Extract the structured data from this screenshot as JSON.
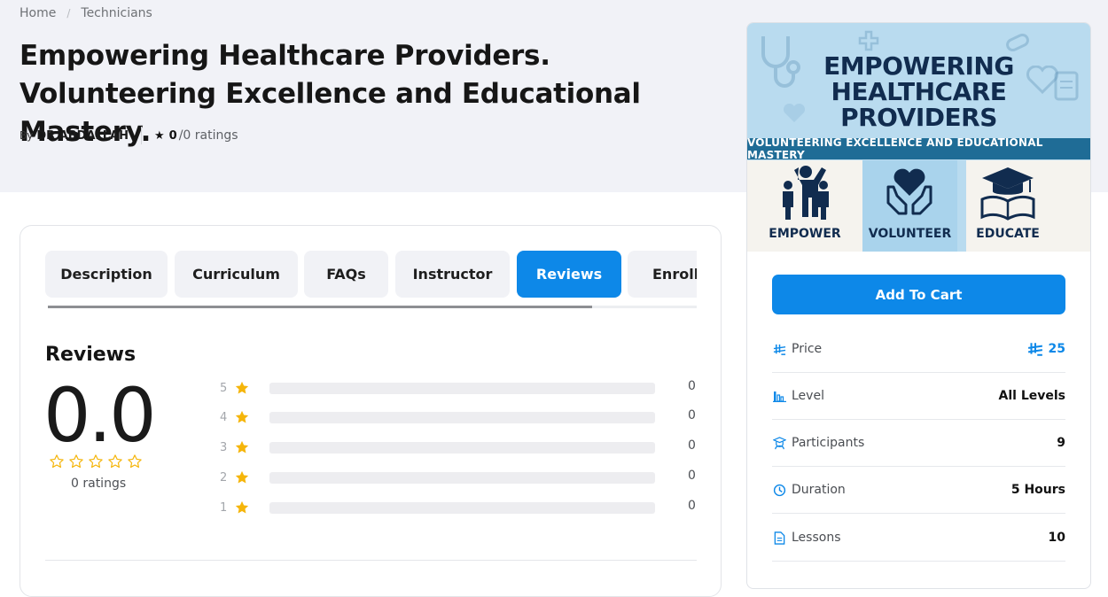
{
  "breadcrumb": {
    "home": "Home",
    "separator": "/",
    "current": "Technicians"
  },
  "course": {
    "title": "Empowering Healthcare Providers. Volunteering Excellence and Educational Mastery.",
    "by_label": "By",
    "author": "DR ABDALLAH",
    "rating_value": "0",
    "rating_text": "/0 ratings"
  },
  "tabs": [
    {
      "label": "Description",
      "active": false
    },
    {
      "label": "Curriculum",
      "active": false
    },
    {
      "label": "FAQs",
      "active": false
    },
    {
      "label": "Instructor",
      "active": false
    },
    {
      "label": "Reviews",
      "active": true
    },
    {
      "label": "Enrolled",
      "active": false
    }
  ],
  "reviews": {
    "heading": "Reviews",
    "average": "0.0",
    "ratings_label": "0 ratings",
    "breakdown": [
      {
        "stars": "5",
        "count": "0"
      },
      {
        "stars": "4",
        "count": "0"
      },
      {
        "stars": "3",
        "count": "0"
      },
      {
        "stars": "2",
        "count": "0"
      },
      {
        "stars": "1",
        "count": "0"
      }
    ]
  },
  "thumbnail": {
    "headline_1": "EMPOWERING",
    "headline_2": "HEALTHCARE",
    "headline_3": "PROVIDERS",
    "band": "VOLUNTEERING EXCELLENCE AND EDUCATIONAL MASTERY",
    "panel_1": "EMPOWER",
    "panel_2": "VOLUNTEER",
    "panel_3": "EDUCATE"
  },
  "sidebar": {
    "cart_button": "Add To Cart",
    "info": [
      {
        "label": "Price",
        "value": "25",
        "icon": "currency-icon"
      },
      {
        "label": "Level",
        "value": "All Levels",
        "icon": "level-bars-icon"
      },
      {
        "label": "Participants",
        "value": "9",
        "icon": "graduate-icon"
      },
      {
        "label": "Duration",
        "value": "5 Hours",
        "icon": "clock-icon"
      },
      {
        "label": "Lessons",
        "value": "10",
        "icon": "document-icon"
      }
    ]
  },
  "colors": {
    "accent": "#0d88e8",
    "star": "#f5b50a",
    "hero_bg": "#f1f2f7",
    "thumb_bg": "#b9dbef",
    "thumb_navy": "#112c4f"
  }
}
